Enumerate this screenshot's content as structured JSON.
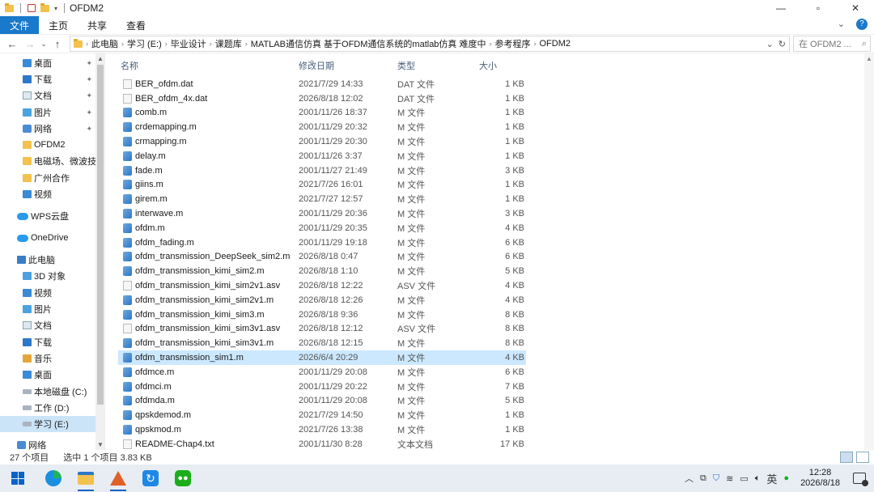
{
  "window": {
    "title": "OFDM2",
    "controls": {
      "minimize": "—",
      "maximize": "▫",
      "close": "✕"
    }
  },
  "ribbon": {
    "tabs": [
      "文件",
      "主页",
      "共享",
      "查看"
    ],
    "active_tab": "文件"
  },
  "address": {
    "crumbs": [
      "此电脑",
      "学习 (E:)",
      "毕业设计",
      "课题库",
      "MATLAB通信仿真 基于OFDM通信系统的matlab仿真 难度中",
      "参考程序",
      "OFDM2"
    ],
    "search_placeholder": "在 OFDM2 ..."
  },
  "nav_pane": {
    "items": [
      {
        "label": "桌面",
        "icon": "desktop-icon",
        "pinned": true
      },
      {
        "label": "下载",
        "icon": "download-icon",
        "pinned": true
      },
      {
        "label": "文档",
        "icon": "document-icon",
        "pinned": true
      },
      {
        "label": "图片",
        "icon": "picture-icon",
        "pinned": true
      },
      {
        "label": "网络",
        "icon": "network-icon",
        "pinned": true
      },
      {
        "label": "OFDM2",
        "icon": "folder-icon",
        "pinned": false
      },
      {
        "label": "电磁场、微波技术",
        "icon": "folder-icon",
        "pinned": false
      },
      {
        "label": "广州合作",
        "icon": "folder-icon",
        "pinned": false
      },
      {
        "label": "视频",
        "icon": "video-icon",
        "pinned": false
      },
      {
        "label": "WPS云盘",
        "icon": "cloud-icon",
        "pinned": false
      },
      {
        "label": "OneDrive",
        "icon": "onedrive-icon",
        "pinned": false
      },
      {
        "label": "此电脑",
        "icon": "pc-icon",
        "pinned": false
      },
      {
        "label": "3D 对象",
        "icon": "3d-objects-icon",
        "pinned": false
      },
      {
        "label": "视频",
        "icon": "video-icon",
        "pinned": false
      },
      {
        "label": "图片",
        "icon": "picture-icon",
        "pinned": false
      },
      {
        "label": "文档",
        "icon": "document-icon",
        "pinned": false
      },
      {
        "label": "下载",
        "icon": "download-icon",
        "pinned": false
      },
      {
        "label": "音乐",
        "icon": "music-icon",
        "pinned": false
      },
      {
        "label": "桌面",
        "icon": "desktop-icon",
        "pinned": false
      },
      {
        "label": "本地磁盘 (C:)",
        "icon": "drive-icon",
        "pinned": false
      },
      {
        "label": "工作 (D:)",
        "icon": "drive-icon",
        "pinned": false
      },
      {
        "label": "学习 (E:)",
        "icon": "drive-icon",
        "pinned": false
      },
      {
        "label": "网络",
        "icon": "network-icon",
        "pinned": false
      }
    ],
    "selected_label": "学习 (E:)"
  },
  "columns": {
    "name": "名称",
    "date": "修改日期",
    "type": "类型",
    "size": "大小"
  },
  "files": [
    {
      "name": "BER_ofdm.dat",
      "date": "2021/7/29 14:33",
      "type": "DAT 文件",
      "size": "1 KB",
      "kind": "txt"
    },
    {
      "name": "BER_ofdm_4x.dat",
      "date": "2026/8/18 12:02",
      "type": "DAT 文件",
      "size": "1 KB",
      "kind": "txt"
    },
    {
      "name": "comb.m",
      "date": "2001/11/26 18:37",
      "type": "M 文件",
      "size": "1 KB",
      "kind": "m"
    },
    {
      "name": "crdemapping.m",
      "date": "2001/11/29 20:32",
      "type": "M 文件",
      "size": "1 KB",
      "kind": "m"
    },
    {
      "name": "crmapping.m",
      "date": "2001/11/29 20:30",
      "type": "M 文件",
      "size": "1 KB",
      "kind": "m"
    },
    {
      "name": "delay.m",
      "date": "2001/11/26 3:37",
      "type": "M 文件",
      "size": "1 KB",
      "kind": "m"
    },
    {
      "name": "fade.m",
      "date": "2001/11/27 21:49",
      "type": "M 文件",
      "size": "3 KB",
      "kind": "m"
    },
    {
      "name": "giins.m",
      "date": "2021/7/26 16:01",
      "type": "M 文件",
      "size": "1 KB",
      "kind": "m"
    },
    {
      "name": "girem.m",
      "date": "2021/7/27 12:57",
      "type": "M 文件",
      "size": "1 KB",
      "kind": "m"
    },
    {
      "name": "interwave.m",
      "date": "2001/11/29 20:36",
      "type": "M 文件",
      "size": "3 KB",
      "kind": "m"
    },
    {
      "name": "ofdm.m",
      "date": "2001/11/29 20:35",
      "type": "M 文件",
      "size": "4 KB",
      "kind": "m"
    },
    {
      "name": "ofdm_fading.m",
      "date": "2001/11/29 19:18",
      "type": "M 文件",
      "size": "6 KB",
      "kind": "m"
    },
    {
      "name": "ofdm_transmission_DeepSeek_sim2.m",
      "date": "2026/8/18 0:47",
      "type": "M 文件",
      "size": "6 KB",
      "kind": "m"
    },
    {
      "name": "ofdm_transmission_kimi_sim2.m",
      "date": "2026/8/18 1:10",
      "type": "M 文件",
      "size": "5 KB",
      "kind": "m"
    },
    {
      "name": "ofdm_transmission_kimi_sim2v1.asv",
      "date": "2026/8/18 12:22",
      "type": "ASV 文件",
      "size": "4 KB",
      "kind": "txt"
    },
    {
      "name": "ofdm_transmission_kimi_sim2v1.m",
      "date": "2026/8/18 12:26",
      "type": "M 文件",
      "size": "4 KB",
      "kind": "m"
    },
    {
      "name": "ofdm_transmission_kimi_sim3.m",
      "date": "2026/8/18 9:36",
      "type": "M 文件",
      "size": "8 KB",
      "kind": "m"
    },
    {
      "name": "ofdm_transmission_kimi_sim3v1.asv",
      "date": "2026/8/18 12:12",
      "type": "ASV 文件",
      "size": "8 KB",
      "kind": "txt"
    },
    {
      "name": "ofdm_transmission_kimi_sim3v1.m",
      "date": "2026/8/18 12:15",
      "type": "M 文件",
      "size": "8 KB",
      "kind": "m"
    },
    {
      "name": "ofdm_transmission_sim1.m",
      "date": "2026/6/4 20:29",
      "type": "M 文件",
      "size": "4 KB",
      "kind": "m"
    },
    {
      "name": "ofdmce.m",
      "date": "2001/11/29 20:08",
      "type": "M 文件",
      "size": "6 KB",
      "kind": "m"
    },
    {
      "name": "ofdmci.m",
      "date": "2001/11/29 20:22",
      "type": "M 文件",
      "size": "7 KB",
      "kind": "m"
    },
    {
      "name": "ofdmda.m",
      "date": "2001/11/29 20:08",
      "type": "M 文件",
      "size": "5 KB",
      "kind": "m"
    },
    {
      "name": "qpskdemod.m",
      "date": "2021/7/29 14:50",
      "type": "M 文件",
      "size": "1 KB",
      "kind": "m"
    },
    {
      "name": "qpskmod.m",
      "date": "2021/7/26 13:38",
      "type": "M 文件",
      "size": "1 KB",
      "kind": "m"
    },
    {
      "name": "README-Chap4.txt",
      "date": "2001/11/30 8:28",
      "type": "文本文档",
      "size": "17 KB",
      "kind": "txt"
    }
  ],
  "selected_file": "ofdm_transmission_sim1.m",
  "status": {
    "count": "27 个项目",
    "selection": "选中 1 个项目  3.83 KB"
  },
  "taskbar": {
    "apps": [
      "start-icon",
      "edge-icon",
      "file-explorer-icon",
      "matlab-icon",
      "refresh-app-icon",
      "wechat-icon"
    ],
    "tray": {
      "ime": "英",
      "time": "12:28",
      "date": "2026/8/18"
    }
  },
  "colors": {
    "accent": "#1979ca",
    "selection": "#cce8ff",
    "taskbar": "#e8edf4"
  }
}
